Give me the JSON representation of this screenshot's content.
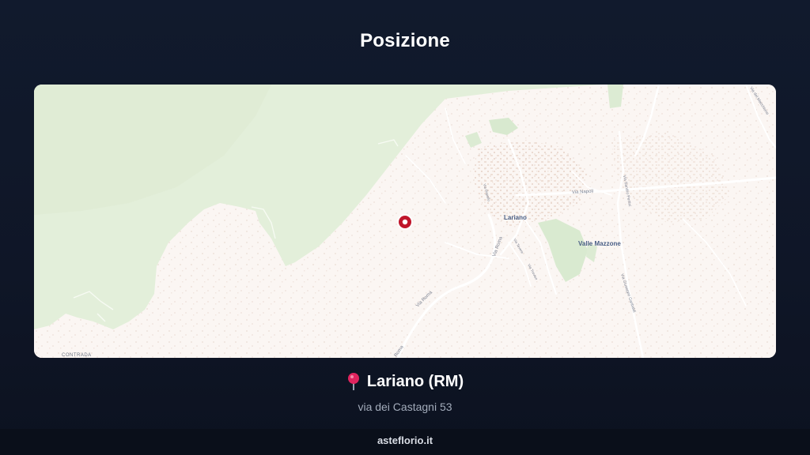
{
  "header": {
    "title": "Posizione"
  },
  "map": {
    "labels": {
      "town": "Lariano",
      "district": "Valle Mazzone",
      "contrada": "CONTRADA",
      "via_napoli": "Via Napoli",
      "via_roma_1": "Via Roma",
      "via_roma_2": "Via Roma",
      "via_roma_3": "Roma",
      "via_sandro_pertini": "Via Sandro Pertini",
      "via_giuseppe_garibaldi": "Via Giuseppe Garibaldi",
      "via_del_macchione": "Via del Macchione",
      "via_tevere": "Via Tevere",
      "via_treviso": "Via Treviso",
      "via_rapallo": "Via Rapallo"
    },
    "colors": {
      "land": "#fbf6f3",
      "forest": "#e3efda",
      "road": "#ffffff",
      "marker": "#c0152a"
    }
  },
  "location": {
    "pin_icon": "round-pushpin-icon",
    "name": "Lariano (RM)",
    "address": "via dei Castagni 53"
  },
  "footer": {
    "site": "asteflorio.it"
  }
}
